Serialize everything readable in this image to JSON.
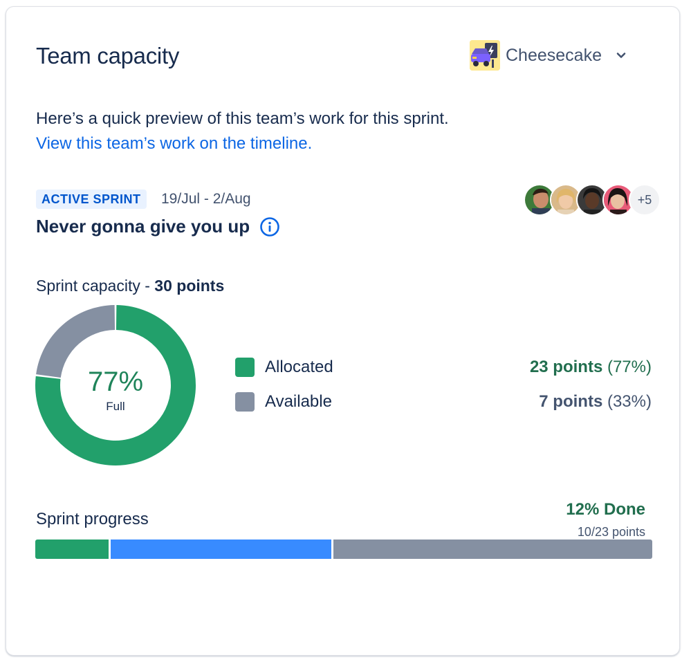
{
  "header": {
    "title": "Team capacity",
    "team_name": "Cheesecake"
  },
  "intro": {
    "description": "Here’s a quick preview of this team’s work for this sprint.",
    "link_text": "View this team’s work on the timeline."
  },
  "sprint": {
    "status": "ACTIVE SPRINT",
    "dates": "19/Jul - 2/Aug",
    "name": "Never gonna give you up",
    "members_overflow": "+5",
    "member_count_shown": 4
  },
  "capacity": {
    "label_prefix": "Sprint capacity - ",
    "label_total": "30 points",
    "percent_text": "77%",
    "percent_sub": "Full",
    "allocated_fraction": 0.77,
    "legend": [
      {
        "label": "Allocated",
        "points": "23 points",
        "pct": "(77%)",
        "color": "#22a06b",
        "value_color": "#216e4e"
      },
      {
        "label": "Available",
        "points": "7 points",
        "pct": "(33%)",
        "color": "#8590a2",
        "value_color": "#44546f"
      }
    ]
  },
  "progress": {
    "label": "Sprint progress",
    "done_text": "12% Done",
    "points_text": "10/23 points",
    "segments": [
      {
        "name": "done",
        "fraction": 0.12,
        "color": "#22a06b"
      },
      {
        "name": "in-progress",
        "fraction": 0.36,
        "color": "#388bff"
      },
      {
        "name": "to-do",
        "fraction": 0.52,
        "color": "#8590a2"
      }
    ]
  },
  "colors": {
    "allocated": "#22a06b",
    "available": "#8590a2",
    "link": "#0c66e4",
    "in_progress": "#388bff"
  }
}
